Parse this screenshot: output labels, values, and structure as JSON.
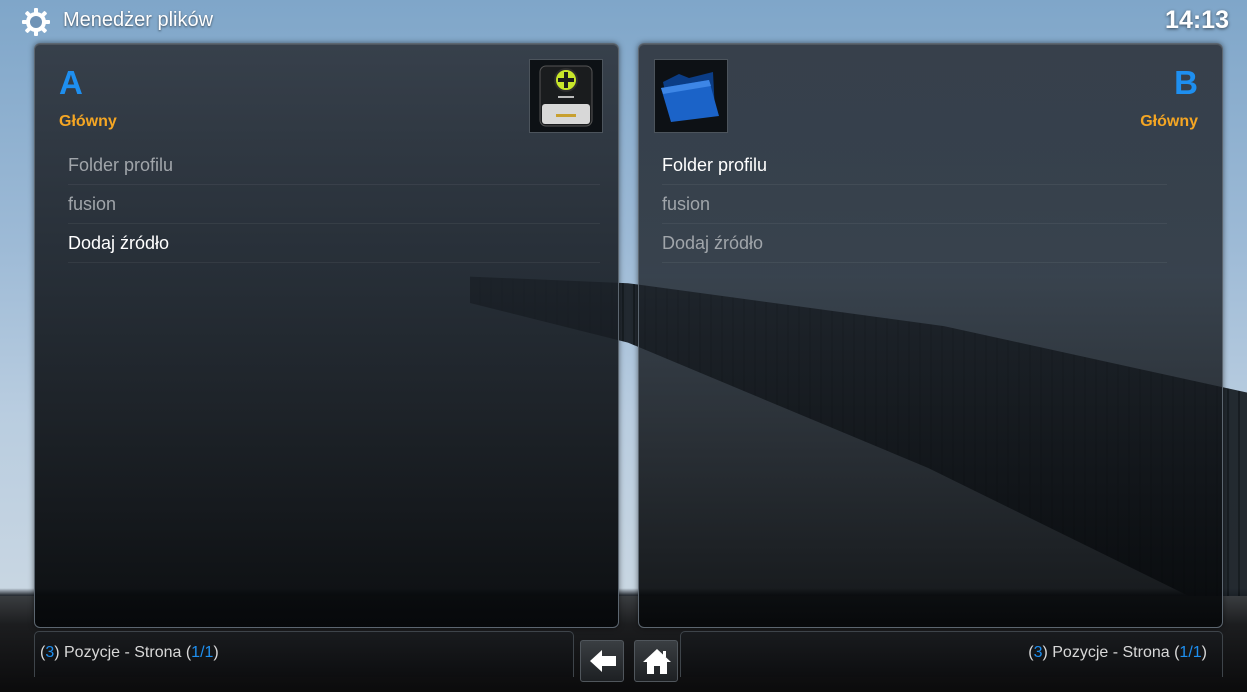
{
  "header": {
    "title": "Menedżer plików",
    "clock": "14:13",
    "icon": "gear-icon"
  },
  "panel_a": {
    "letter": "A",
    "subtitle": "Główny",
    "thumbnail_icon": "add-source-drive-icon",
    "items": [
      {
        "label": "Folder profilu",
        "active": false
      },
      {
        "label": "fusion",
        "active": false
      },
      {
        "label": "Dodaj źródło",
        "active": true
      }
    ],
    "footer": {
      "count": "3",
      "text_mid": ") Pozycje - Strona (",
      "page": "1/1",
      "open": "(",
      "close": ")"
    }
  },
  "panel_b": {
    "letter": "B",
    "subtitle": "Główny",
    "thumbnail_icon": "blue-folder-icon",
    "items": [
      {
        "label": "Folder profilu",
        "active": true
      },
      {
        "label": "fusion",
        "active": false
      },
      {
        "label": "Dodaj źródło",
        "active": false
      }
    ],
    "footer": {
      "count": "3",
      "text_mid": ") Pozycje - Strona (",
      "page": "1/1",
      "open": "(",
      "close": ")"
    }
  },
  "nav": {
    "back_icon": "back-arrow-icon",
    "home_icon": "home-icon"
  },
  "colors": {
    "accent_blue": "#1e8ff0",
    "accent_orange": "#f5a623"
  }
}
